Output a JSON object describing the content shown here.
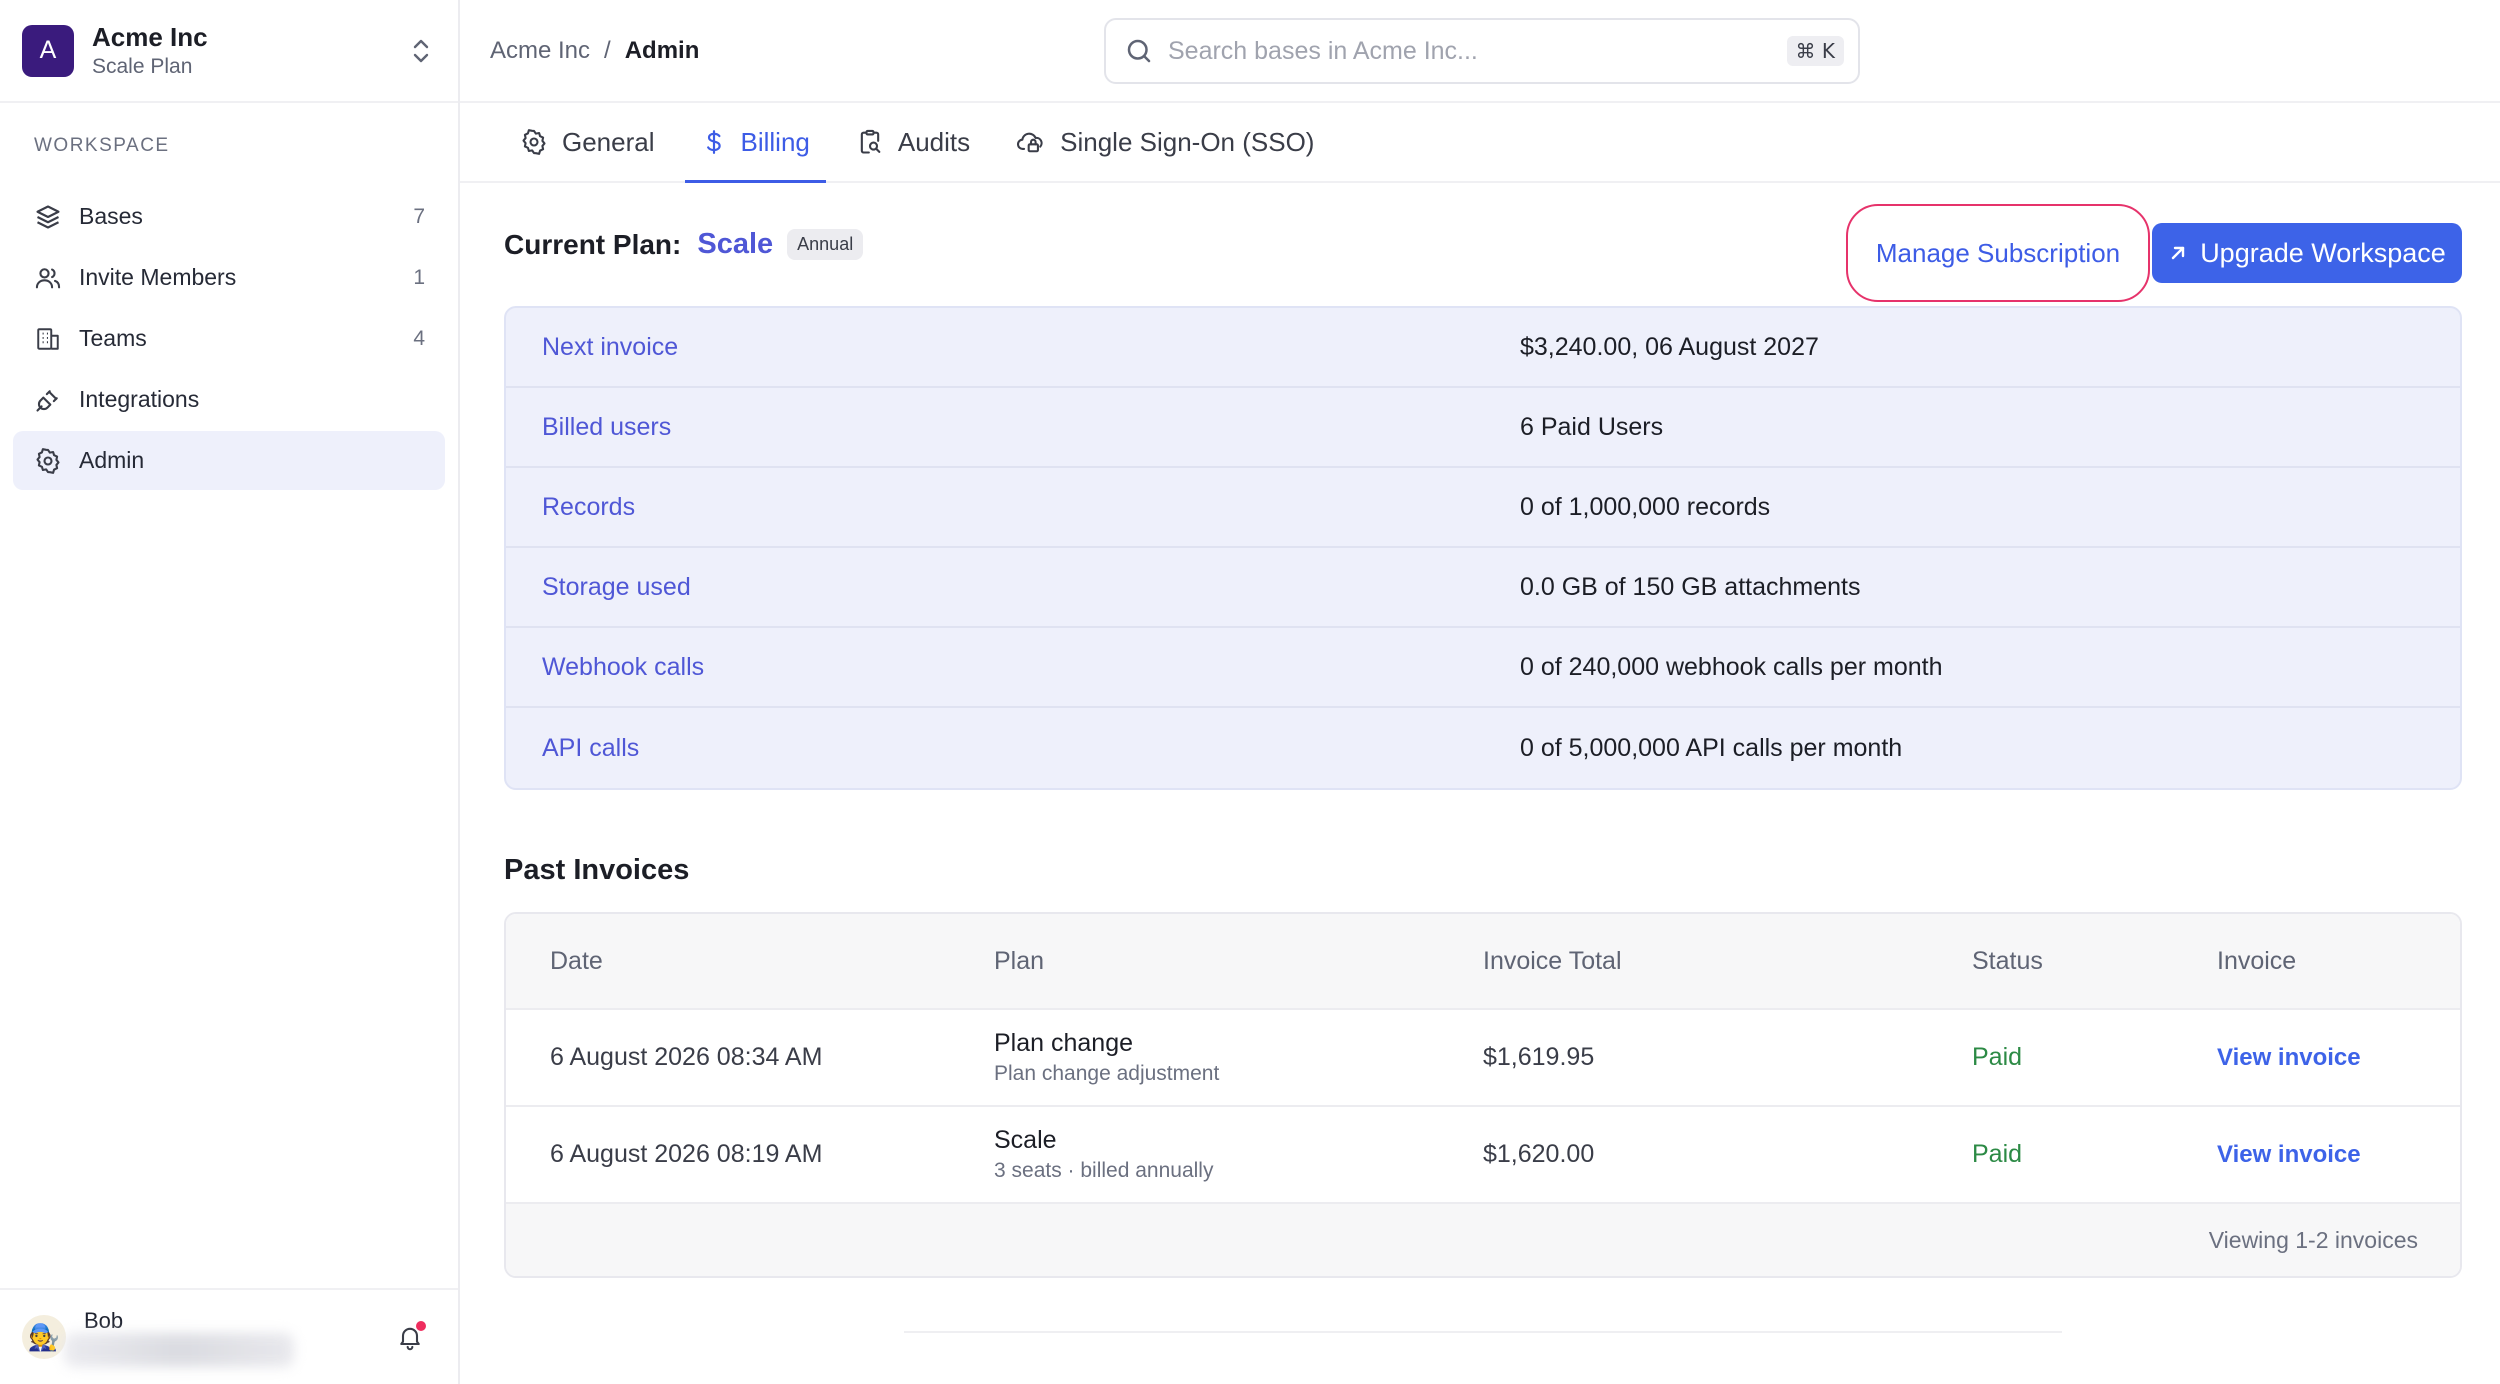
{
  "workspace": {
    "initial": "A",
    "name": "Acme Inc",
    "plan": "Scale Plan"
  },
  "sidebar": {
    "section_label": "WORKSPACE",
    "items": [
      {
        "label": "Bases",
        "count": "7",
        "icon": "database-icon"
      },
      {
        "label": "Invite Members",
        "count": "1",
        "icon": "users-icon"
      },
      {
        "label": "Teams",
        "count": "4",
        "icon": "building-icon"
      },
      {
        "label": "Integrations",
        "count": "",
        "icon": "plug-icon"
      },
      {
        "label": "Admin",
        "count": "",
        "icon": "gear-icon",
        "active": true
      }
    ]
  },
  "user": {
    "name": "Bob",
    "avatar": "🧑‍🔧"
  },
  "breadcrumb": {
    "root": "Acme Inc",
    "separator": "/",
    "current": "Admin"
  },
  "search": {
    "placeholder": "Search bases in Acme Inc...",
    "shortcut": "⌘ K"
  },
  "tabs": [
    {
      "label": "General",
      "icon": "gear-icon"
    },
    {
      "label": "Billing",
      "icon": "dollar-icon",
      "active": true
    },
    {
      "label": "Audits",
      "icon": "clipboard-search-icon"
    },
    {
      "label": "Single Sign-On (SSO)",
      "icon": "cloud-lock-icon"
    }
  ],
  "plan": {
    "title": "Current Plan:",
    "name": "Scale",
    "badge": "Annual",
    "manage_label": "Manage Subscription",
    "upgrade_label": "Upgrade Workspace"
  },
  "details": [
    {
      "label": "Next invoice",
      "value": "$3,240.00, 06 August 2027"
    },
    {
      "label": "Billed users",
      "value": "6 Paid Users"
    },
    {
      "label": "Records",
      "value": "0 of 1,000,000 records"
    },
    {
      "label": "Storage used",
      "value": "0.0 GB of 150 GB attachments"
    },
    {
      "label": "Webhook calls",
      "value": "0 of 240,000 webhook calls per month"
    },
    {
      "label": "API calls",
      "value": "0 of 5,000,000 API calls per month"
    }
  ],
  "invoices": {
    "title": "Past Invoices",
    "columns": [
      "Date",
      "Plan",
      "Invoice Total",
      "Status",
      "Invoice"
    ],
    "rows": [
      {
        "date": "6 August 2026 08:34 AM",
        "plan": "Plan change",
        "plan_sub": "Plan change adjustment",
        "total": "$1,619.95",
        "status": "Paid",
        "link": "View invoice"
      },
      {
        "date": "6 August 2026 08:19 AM",
        "plan": "Scale",
        "plan_sub": "3 seats · billed annually",
        "total": "$1,620.00",
        "status": "Paid",
        "link": "View invoice"
      }
    ],
    "footer": "Viewing 1-2 invoices"
  },
  "colors": {
    "accent": "#3d63e8",
    "label_purple": "#4f57d6",
    "paid_green": "#2c8a45",
    "highlight_ring": "#e6336b"
  }
}
